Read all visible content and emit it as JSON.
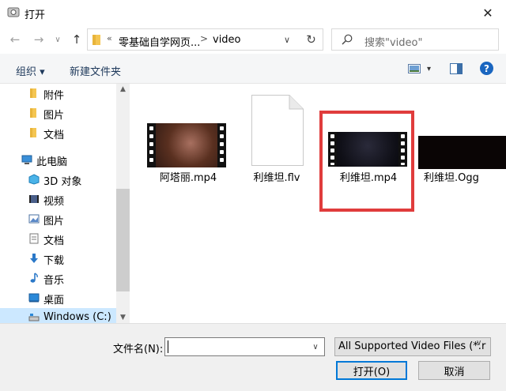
{
  "window": {
    "title": "打开",
    "close_glyph": "✕"
  },
  "nav": {
    "back_glyph": "←",
    "forward_glyph": "→",
    "dropdown_glyph": "∨",
    "up_glyph": "↑"
  },
  "address": {
    "overflow": "«",
    "crumbs": [
      "零基础自学网页...",
      "video"
    ],
    "separator": ">",
    "dropdown_glyph": "∨",
    "refresh_glyph": "↻"
  },
  "search": {
    "placeholder": "搜索\"video\""
  },
  "toolbar": {
    "organize": "组织 ▾",
    "new_folder": "新建文件夹",
    "view_dropdown": "▾",
    "help": "?"
  },
  "sidebar": {
    "items": [
      {
        "label": "附件",
        "icon": "folder-icon"
      },
      {
        "label": "图片",
        "icon": "folder-icon"
      },
      {
        "label": "文档",
        "icon": "folder-icon"
      },
      {
        "label": "此电脑",
        "icon": "computer-icon"
      },
      {
        "label": "3D 对象",
        "icon": "3d-objects-icon"
      },
      {
        "label": "视频",
        "icon": "video-icon"
      },
      {
        "label": "图片",
        "icon": "pictures-icon"
      },
      {
        "label": "文档",
        "icon": "documents-icon"
      },
      {
        "label": "下载",
        "icon": "download-icon"
      },
      {
        "label": "音乐",
        "icon": "music-icon"
      },
      {
        "label": "桌面",
        "icon": "desktop-icon"
      },
      {
        "label": "Windows (C:)",
        "icon": "drive-icon"
      }
    ],
    "scroll_up": "▲",
    "scroll_down": "▼"
  },
  "files": [
    {
      "name": "阿塔丽.mp4",
      "type": "video-thumbnail"
    },
    {
      "name": "利维坦.flv",
      "type": "blank-document"
    },
    {
      "name": "利维坦.mp4",
      "type": "video-thumbnail",
      "highlighted": true
    },
    {
      "name": "利维坦.Ogg",
      "type": "video-thumbnail"
    }
  ],
  "footer": {
    "filename_label": "文件名(N):",
    "filename_value": "",
    "filename_dropdown": "∨",
    "filetype": "All Supported Video Files (*.r",
    "filetype_dropdown": "∨",
    "open": "打开(O)",
    "cancel": "取消"
  },
  "colors": {
    "accent": "#0078d7",
    "highlight_border": "#e03c3c",
    "selected_bg": "#cce8ff"
  }
}
